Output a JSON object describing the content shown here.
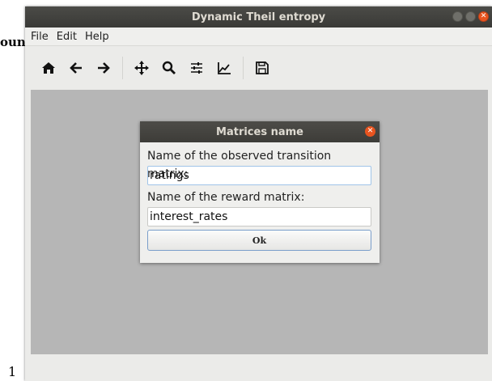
{
  "background": {
    "left_fragment": "oun",
    "number": "1"
  },
  "window": {
    "title": "Dynamic Theil entropy",
    "menu": [
      "File",
      "Edit",
      "Help"
    ],
    "toolbar": [
      "home-icon",
      "back-arrow-icon",
      "forward-arrow-icon",
      "pan-icon",
      "zoom-icon",
      "configure-subplots-icon",
      "edit-axis-icon",
      "save-icon"
    ]
  },
  "dialog": {
    "title": "Matrices name",
    "label_observed": "Name of the observed transition matrix:",
    "value_observed": "ratings",
    "label_reward": "Name of the reward matrix:",
    "value_reward": "interest_rates",
    "ok_label": "Ok"
  },
  "colors": {
    "accent": "#e9541f",
    "titlebar": "#3d3c38",
    "canvas": "#b6b6b6"
  }
}
